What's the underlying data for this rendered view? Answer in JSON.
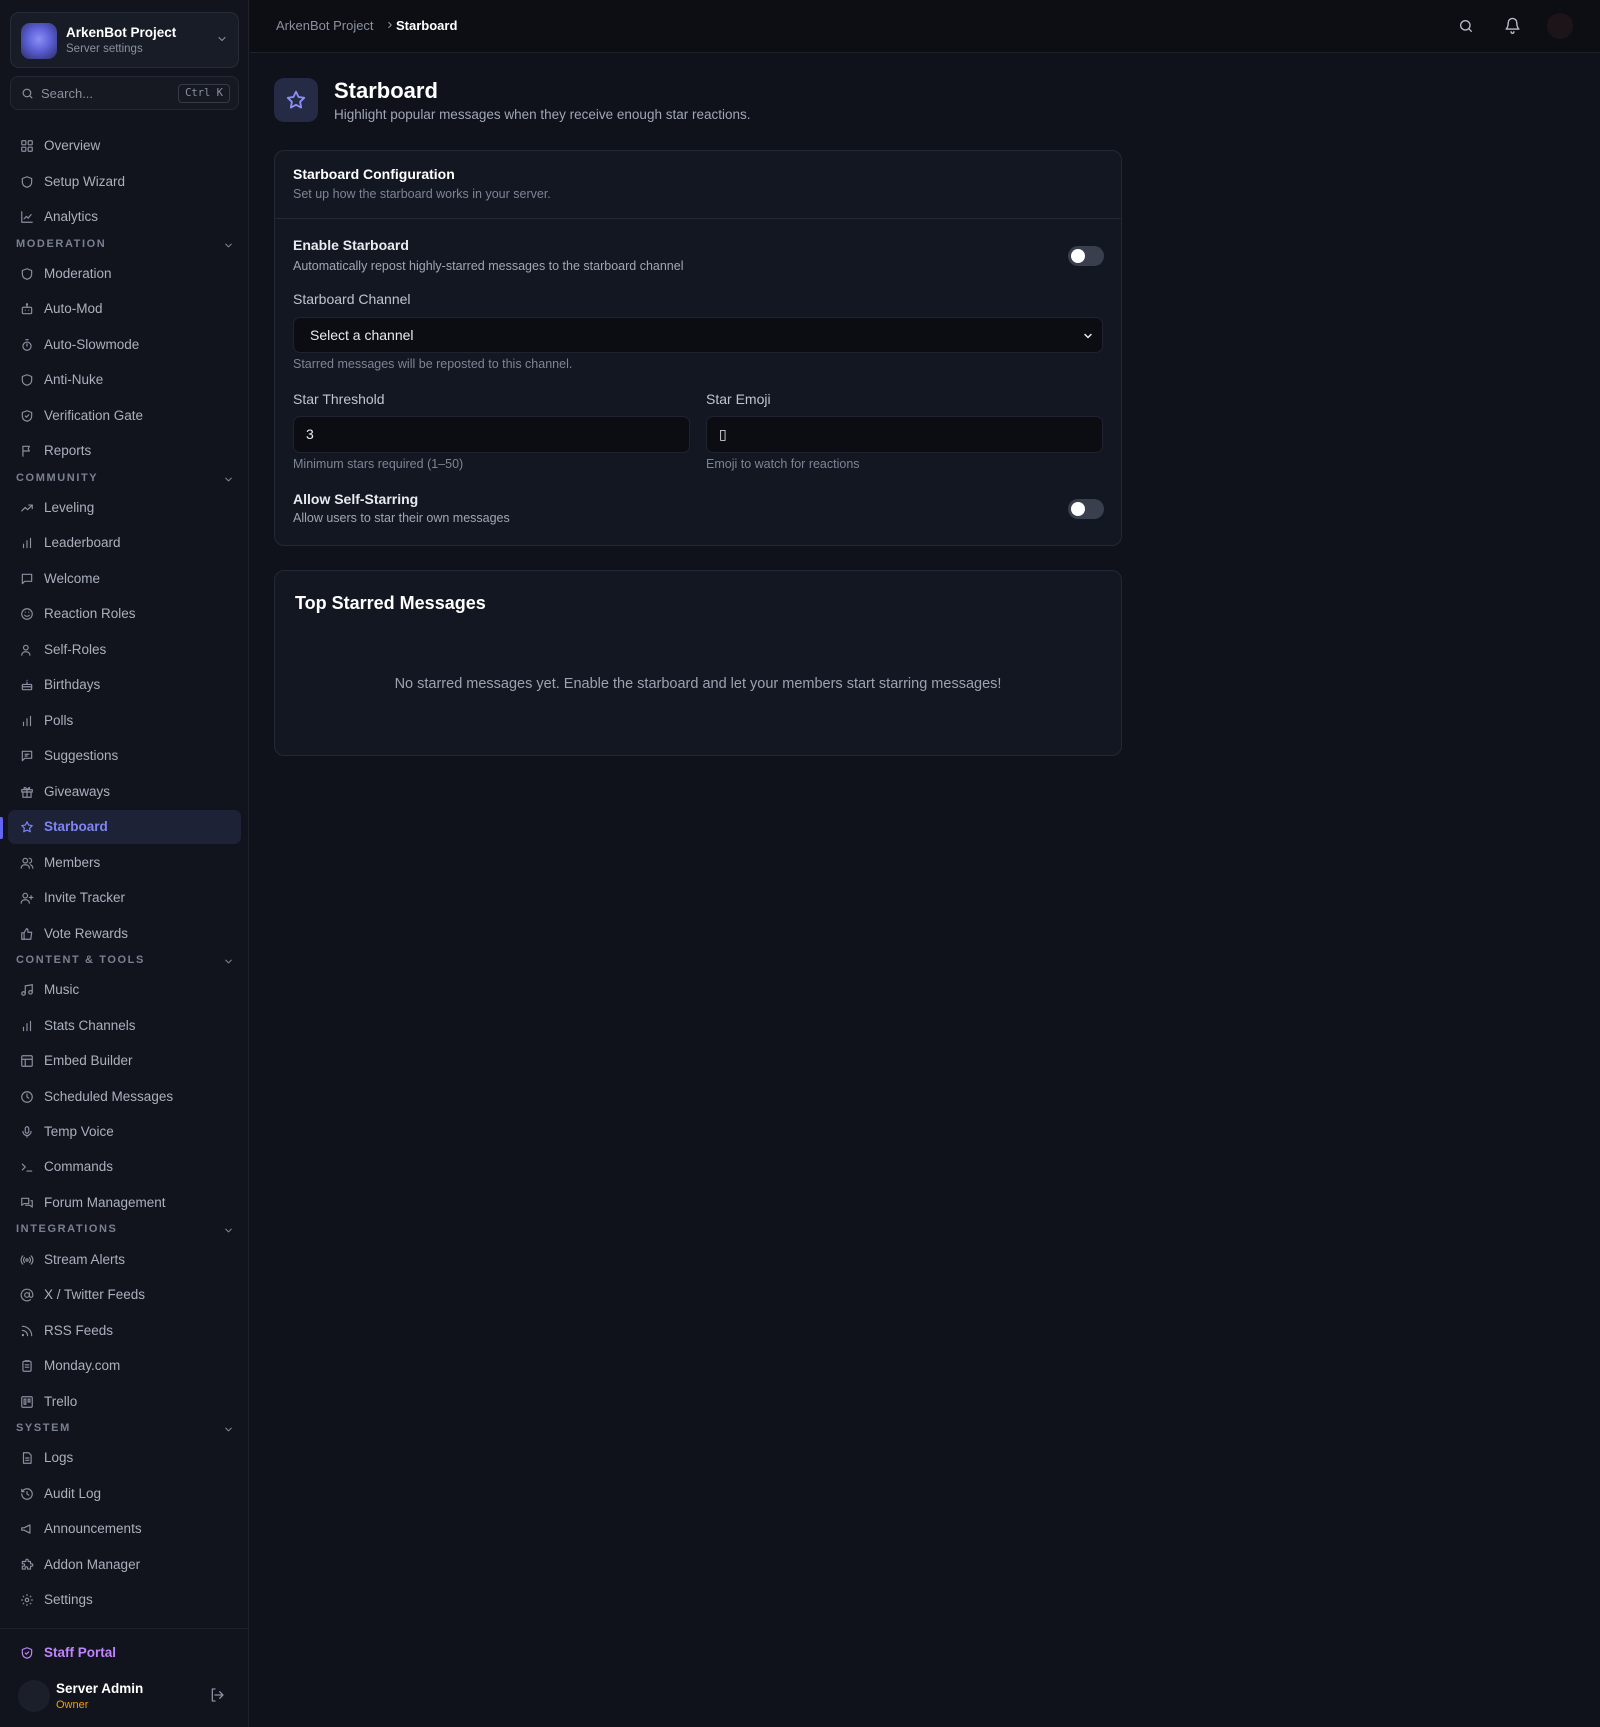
{
  "project": {
    "name": "ArkenBot Project",
    "subtitle": "Server settings"
  },
  "search": {
    "placeholder": "Search...",
    "shortcut": "Ctrl K"
  },
  "nav": {
    "top": [
      {
        "label": "Overview",
        "icon": "grid-icon"
      },
      {
        "label": "Setup Wizard",
        "icon": "shield-icon"
      },
      {
        "label": "Analytics",
        "icon": "line-chart-icon"
      }
    ],
    "moderation_header": "MODERATION",
    "moderation": [
      {
        "label": "Moderation",
        "icon": "shield-icon"
      },
      {
        "label": "Auto-Mod",
        "icon": "bot-icon"
      },
      {
        "label": "Auto-Slowmode",
        "icon": "timer-icon"
      },
      {
        "label": "Anti-Nuke",
        "icon": "shield-icon"
      },
      {
        "label": "Verification Gate",
        "icon": "shield-check-icon"
      },
      {
        "label": "Reports",
        "icon": "flag-icon"
      }
    ],
    "community_header": "COMMUNITY",
    "community": [
      {
        "label": "Leveling",
        "icon": "trending-up-icon"
      },
      {
        "label": "Leaderboard",
        "icon": "bar-chart-icon"
      },
      {
        "label": "Welcome",
        "icon": "message-icon"
      },
      {
        "label": "Reaction Roles",
        "icon": "smile-icon"
      },
      {
        "label": "Self-Roles",
        "icon": "user-icon"
      },
      {
        "label": "Birthdays",
        "icon": "cake-icon"
      },
      {
        "label": "Polls",
        "icon": "bar-chart-icon"
      },
      {
        "label": "Suggestions",
        "icon": "message-square-icon"
      },
      {
        "label": "Giveaways",
        "icon": "gift-icon"
      },
      {
        "label": "Starboard",
        "icon": "star-icon"
      },
      {
        "label": "Members",
        "icon": "users-icon"
      },
      {
        "label": "Invite Tracker",
        "icon": "user-plus-icon"
      },
      {
        "label": "Vote Rewards",
        "icon": "thumbs-up-icon"
      }
    ],
    "content_header": "CONTENT & TOOLS",
    "content": [
      {
        "label": "Music",
        "icon": "music-icon"
      },
      {
        "label": "Stats Channels",
        "icon": "bar-chart-icon"
      },
      {
        "label": "Embed Builder",
        "icon": "layout-icon"
      },
      {
        "label": "Scheduled Messages",
        "icon": "clock-icon"
      },
      {
        "label": "Temp Voice",
        "icon": "mic-icon"
      },
      {
        "label": "Commands",
        "icon": "terminal-icon"
      },
      {
        "label": "Forum Management",
        "icon": "messages-icon"
      }
    ],
    "integrations_header": "INTEGRATIONS",
    "integrations": [
      {
        "label": "Stream Alerts",
        "icon": "radio-icon"
      },
      {
        "label": "X / Twitter Feeds",
        "icon": "at-sign-icon"
      },
      {
        "label": "RSS Feeds",
        "icon": "rss-icon"
      },
      {
        "label": "Monday.com",
        "icon": "clipboard-icon"
      },
      {
        "label": "Trello",
        "icon": "trello-icon"
      }
    ],
    "system_header": "SYSTEM",
    "system": [
      {
        "label": "Logs",
        "icon": "file-icon"
      },
      {
        "label": "Audit Log",
        "icon": "history-icon"
      },
      {
        "label": "Announcements",
        "icon": "megaphone-icon"
      },
      {
        "label": "Addon Manager",
        "icon": "puzzle-icon"
      },
      {
        "label": "Settings",
        "icon": "gear-icon"
      }
    ],
    "active": "Starboard",
    "staff_portal": "Staff Portal"
  },
  "user": {
    "name": "Server Admin",
    "role": "Owner"
  },
  "breadcrumb": {
    "parent": "ArkenBot Project",
    "current": "Starboard"
  },
  "page": {
    "title": "Starboard",
    "subtitle": "Highlight popular messages when they receive enough star reactions."
  },
  "config": {
    "title": "Starboard Configuration",
    "subtitle": "Set up how the starboard works in your server.",
    "enable": {
      "title": "Enable Starboard",
      "desc": "Automatically repost highly-starred messages to the starboard channel",
      "enabled": false
    },
    "channel": {
      "label": "Starboard Channel",
      "value": "Select a channel",
      "help": "Starred messages will be reposted to this channel."
    },
    "threshold": {
      "label": "Star Threshold",
      "value": "3",
      "help": "Minimum stars required (1–50)"
    },
    "emoji": {
      "label": "Star Emoji",
      "value": "▯",
      "help": "Emoji to watch for reactions"
    },
    "self_star": {
      "title": "Allow Self-Starring",
      "desc": "Allow users to star their own messages",
      "enabled": false
    }
  },
  "top": {
    "title": "Top Starred Messages",
    "empty": "No starred messages yet. Enable the starboard and let your members start starring messages!"
  },
  "colors": {
    "accent": "#6366f1",
    "staff": "#c084fc",
    "owner": "#f59e0b",
    "background": "#0f121b"
  }
}
